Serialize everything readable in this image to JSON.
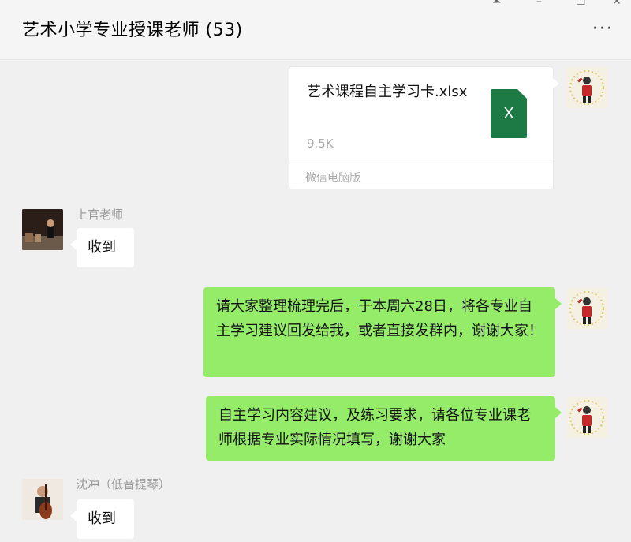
{
  "window": {
    "title": "艺术小学专业授课老师 (53)",
    "more_label": "···",
    "controls": {
      "pin": "⏶",
      "minimize": "–",
      "maximize": "☐",
      "close": "✕"
    }
  },
  "messages": [
    {
      "type": "file",
      "sender": "self",
      "file_name": "艺术课程自主学习卡.xlsx",
      "file_size": "9.5K",
      "file_icon_letter": "X",
      "source": "微信电脑版"
    },
    {
      "type": "text",
      "sender_name": "上官老师",
      "text": "收到"
    },
    {
      "type": "text",
      "sender": "self",
      "text": "请大家整理梳理完后，于本周六28日，将各专业自主学习建议回发给我，或者直接发群内，谢谢大家！"
    },
    {
      "type": "text",
      "sender": "self",
      "text": "自主学习内容建议，及练习要求，请各位专业课老师根据专业实际情况填写，谢谢大家"
    },
    {
      "type": "text",
      "sender_name": "沈冲（低音提琴）",
      "text": "收到"
    }
  ],
  "colors": {
    "self_bubble": "#95ec69",
    "other_bubble": "#ffffff",
    "excel_green": "#1d7a45"
  }
}
